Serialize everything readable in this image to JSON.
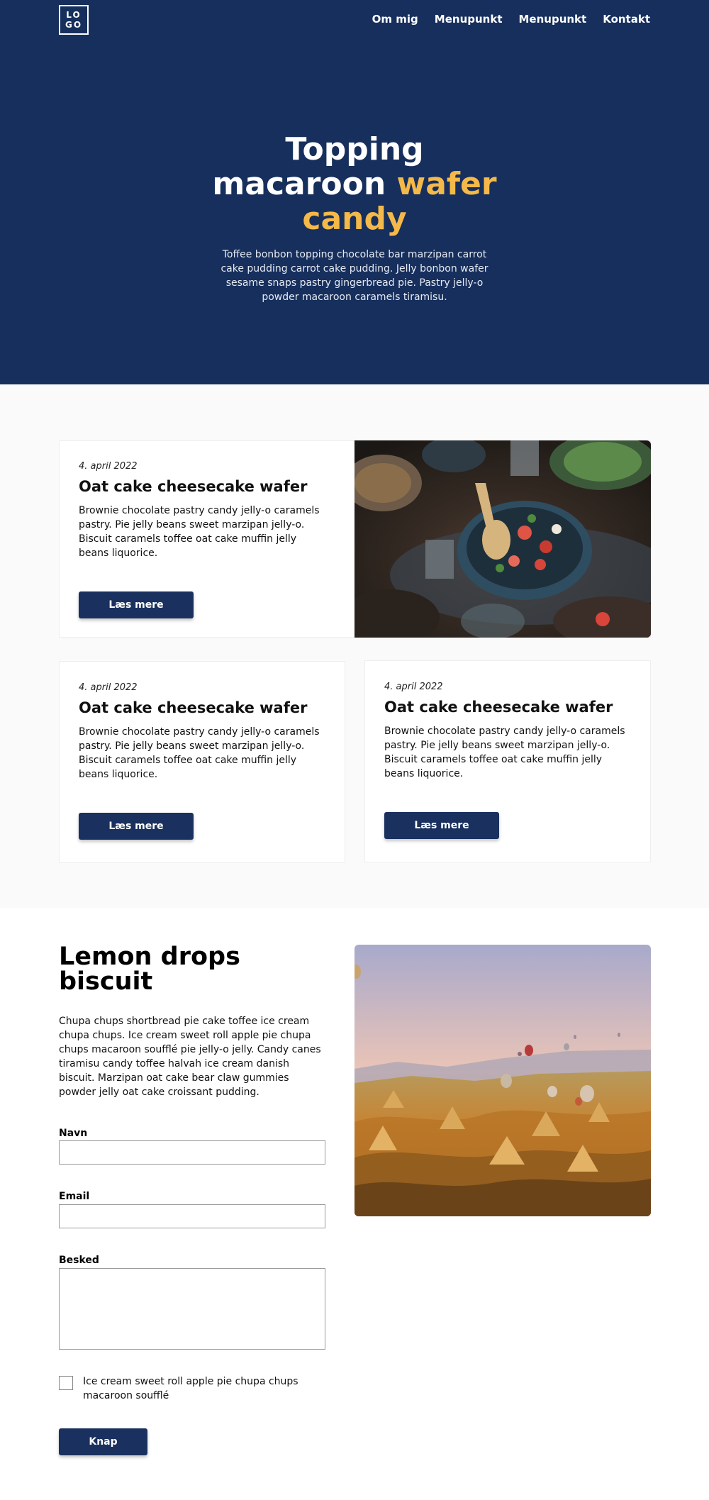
{
  "header": {
    "logo_line1": "LO",
    "logo_line2": "GO",
    "nav": [
      "Om mig",
      "Menupunkt",
      "Menupunkt",
      "Kontakt"
    ]
  },
  "hero": {
    "title_line1": "Topping",
    "title_line2": "macaroon",
    "title_accent1": "wafer",
    "title_accent2": "candy",
    "subtitle": "Toffee bonbon topping chocolate bar marzipan carrot cake pudding carrot cake pudding. Jelly bonbon wafer sesame snaps pastry gingerbread pie. Pastry jelly-o powder macaroon caramels tiramisu."
  },
  "cards": [
    {
      "date": "4. april 2022",
      "title": "Oat cake cheesecake wafer",
      "text": "Brownie chocolate pastry candy jelly-o caramels pastry. Pie jelly beans sweet marzipan jelly-o. Biscuit caramels toffee oat cake muffin jelly beans liquorice.",
      "button": "Læs mere"
    },
    {
      "date": "4. april 2022",
      "title": "Oat cake cheesecake wafer",
      "text": "Brownie chocolate pastry candy jelly-o caramels pastry. Pie jelly beans sweet marzipan jelly-o. Biscuit caramels toffee oat cake muffin jelly beans liquorice.",
      "button": "Læs mere"
    },
    {
      "date": "4. april 2022",
      "title": "Oat cake cheesecake wafer",
      "text": "Brownie chocolate pastry candy jelly-o caramels pastry. Pie jelly beans sweet marzipan jelly-o. Biscuit caramels toffee oat cake muffin jelly beans liquorice.",
      "button": "Læs mere"
    }
  ],
  "contact": {
    "title": "Lemon drops biscuit",
    "text": "Chupa chups shortbread pie cake toffee ice cream chupa chups. Ice cream sweet roll apple pie chupa chups macaroon soufflé pie jelly-o jelly. Candy canes tiramisu candy toffee halvah ice cream danish biscuit. Marzipan oat cake bear claw gummies powder jelly oat cake croissant pudding.",
    "name_label": "Navn",
    "email_label": "Email",
    "message_label": "Besked",
    "checkbox_label": "Ice cream sweet roll apple pie chupa chups macaroon soufflé",
    "submit": "Knap"
  },
  "colors": {
    "primary": "#172f5c",
    "accent": "#f5b949",
    "button": "#1a315f",
    "section_bg": "#fafafa"
  }
}
